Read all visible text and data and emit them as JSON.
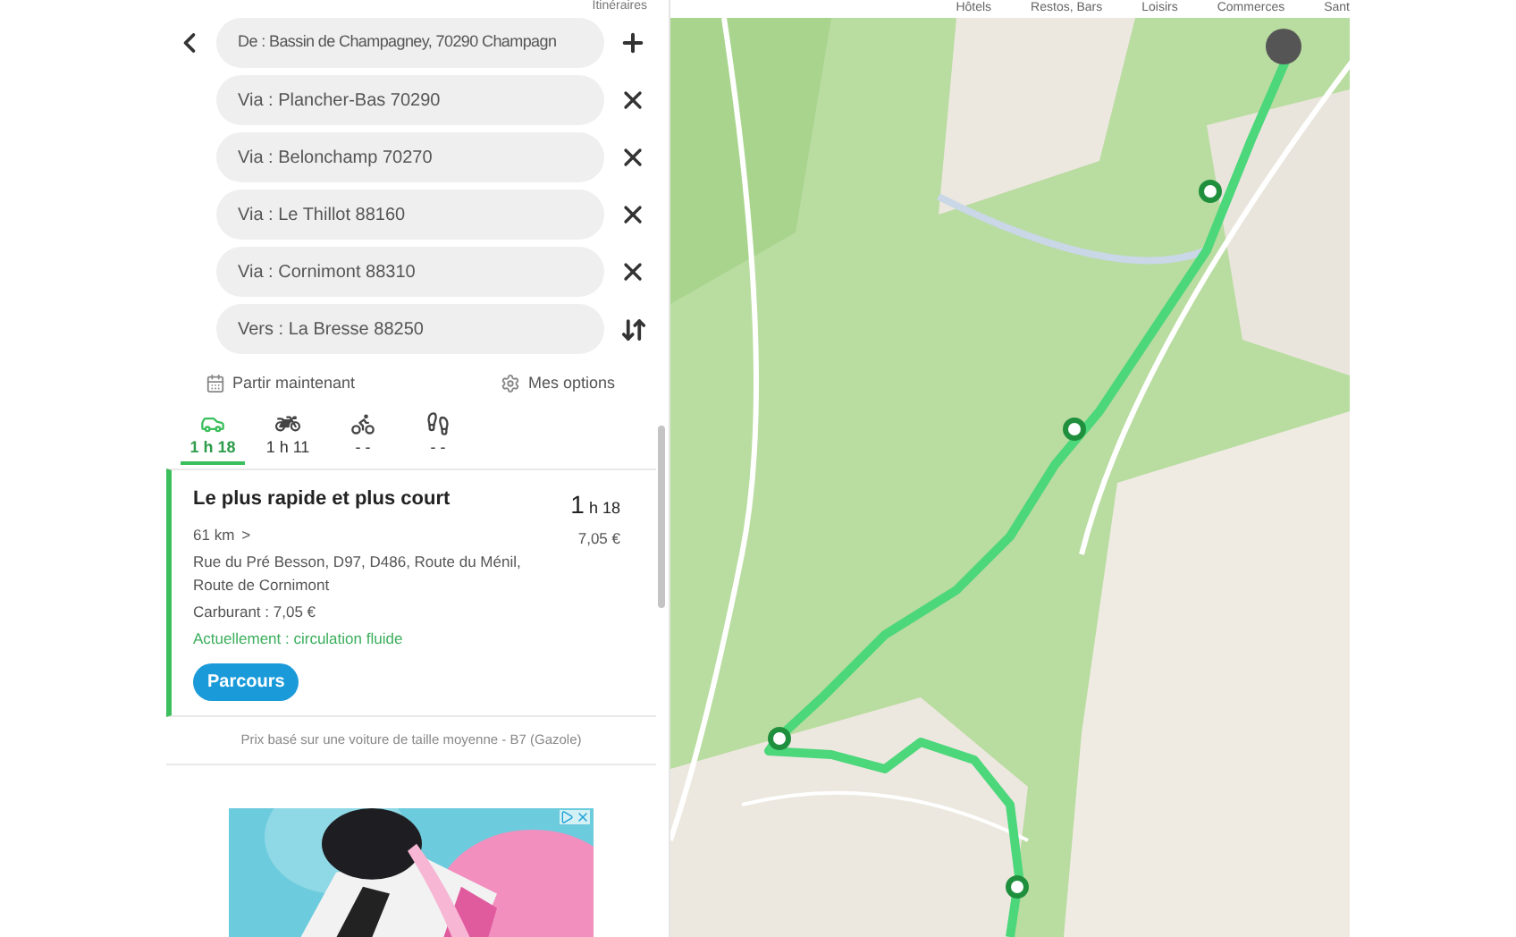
{
  "header": {
    "title": "Itinéraires"
  },
  "map_categories": [
    "Hôtels",
    "Restos, Bars",
    "Loisirs",
    "Commerces",
    "Sant"
  ],
  "route_points": [
    {
      "kind": "start",
      "value": "De : Bassin de Champagney, 70290 Champagn"
    },
    {
      "kind": "via",
      "value": "Via : Plancher-Bas 70290"
    },
    {
      "kind": "via",
      "value": "Via : Belonchamp 70270"
    },
    {
      "kind": "via",
      "value": "Via : Le Thillot 88160"
    },
    {
      "kind": "via",
      "value": "Via : Cornimont 88310"
    },
    {
      "kind": "end",
      "value": "Vers : La Bresse 88250"
    }
  ],
  "options": {
    "depart": "Partir maintenant",
    "settings": "Mes options"
  },
  "modes": [
    {
      "kind": "car",
      "time": "1 h 18",
      "selected": true
    },
    {
      "kind": "motorbike",
      "time": "1 h 11",
      "selected": false
    },
    {
      "kind": "bicycle",
      "time": "- -",
      "selected": false
    },
    {
      "kind": "walk",
      "time": "- -",
      "selected": false
    }
  ],
  "result": {
    "title": "Le plus rapide et plus court",
    "distance": "61 km",
    "arrow": ">",
    "roads": "Rue du Pré Besson, D97, D486, Route du Ménil, Route de Cornimont",
    "fuel": "Carburant : 7,05 €",
    "traffic": "Actuellement : circulation fluide",
    "duration_big": "1",
    "duration_rest": "h 18",
    "price": "7,05 €",
    "button": "Parcours"
  },
  "footnote": "Prix basé sur une voiture de taille moyenne - B7 (Gazole)"
}
